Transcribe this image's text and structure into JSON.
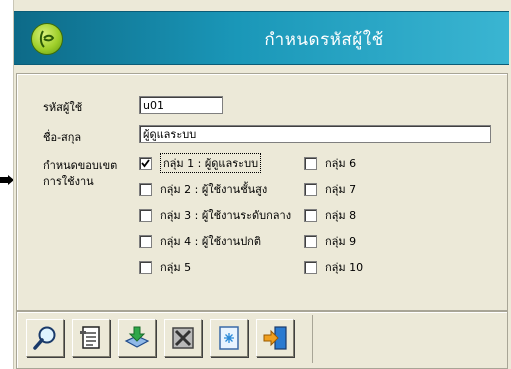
{
  "window": {
    "title": "กำหนดรหัสผู้ใช้"
  },
  "form": {
    "user_id_label": "รหัสผู้ใช้",
    "user_id_value": "u01",
    "name_label": "ชื่อ-สกุล",
    "name_value": "ผู้ดูแลระบบ",
    "scope_label_line1": "กำหนดขอบเขต",
    "scope_label_line2": "การใช้งาน",
    "groups": [
      {
        "label": "กลุ่ม 1 : ผู้ดูแลระบบ",
        "checked": true
      },
      {
        "label": "กลุ่ม 2 : ผู้ใช้งานชั้นสูง",
        "checked": false
      },
      {
        "label": "กลุ่ม 3 : ผู้ใช้งานระดับกลาง",
        "checked": false
      },
      {
        "label": "กลุ่ม 4 : ผู้ใช้งานปกติ",
        "checked": false
      },
      {
        "label": "กลุ่ม 5",
        "checked": false
      },
      {
        "label": "กลุ่ม 6",
        "checked": false
      },
      {
        "label": "กลุ่ม 7",
        "checked": false
      },
      {
        "label": "กลุ่ม 8",
        "checked": false
      },
      {
        "label": "กลุ่ม 9",
        "checked": false
      },
      {
        "label": "กลุ่ม 10",
        "checked": false
      }
    ]
  },
  "toolbar": {
    "buttons": [
      "search-icon",
      "edit-document-icon",
      "save-download-icon",
      "delete-icon",
      "new-document-icon",
      "exit-icon"
    ]
  },
  "colors": {
    "title_bar": "#1a97b8",
    "window_bg": "#ece9d8"
  }
}
